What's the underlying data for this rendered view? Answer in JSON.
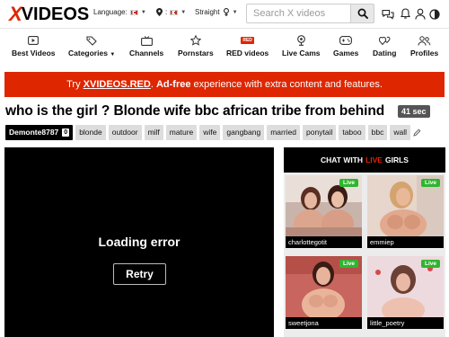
{
  "header": {
    "logo_x": "X",
    "logo_text": "VIDEOS",
    "language_label": "Language:",
    "location_label": ":",
    "orientation_label": "Straight",
    "search_placeholder": "Search X videos"
  },
  "nav": [
    {
      "label": "Best Videos",
      "icon": "play-square-icon"
    },
    {
      "label": "Categories",
      "icon": "tags-icon"
    },
    {
      "label": "Channels",
      "icon": "tv-icon"
    },
    {
      "label": "Pornstars",
      "icon": "star-icon"
    },
    {
      "label": "RED videos",
      "icon": "red-badge-icon",
      "badge": "RED"
    },
    {
      "label": "Live Cams",
      "icon": "webcam-icon"
    },
    {
      "label": "Games",
      "icon": "gamepad-icon"
    },
    {
      "label": "Dating",
      "icon": "hearts-icon"
    },
    {
      "label": "Profiles",
      "icon": "profiles-icon"
    }
  ],
  "promo": {
    "prefix": "Try ",
    "brand": "XVIDEOS.RED",
    "middle": ". ",
    "adfree": "Ad-free",
    "suffix": " experience with extra content and features."
  },
  "video": {
    "title": "who is the girl ? Blonde wife bbc african tribe from behind",
    "duration": "41 sec",
    "uploader": "Demonte8787",
    "uploader_count": "0",
    "tags": [
      "blonde",
      "outdoor",
      "milf",
      "mature",
      "wife",
      "gangbang",
      "married",
      "ponytail",
      "taboo",
      "bbc",
      "wall"
    ]
  },
  "player": {
    "error_text": "Loading error",
    "retry_label": "Retry"
  },
  "live": {
    "head_prefix": "CHAT WITH",
    "head_live": "LIVE",
    "head_suffix": "GIRLS",
    "badge": "Live",
    "cams": [
      {
        "name": "charlottegotit"
      },
      {
        "name": "emmiep"
      },
      {
        "name": "sweetjona"
      },
      {
        "name": "little_poetry"
      }
    ]
  },
  "colors": {
    "brand_red": "#de2600",
    "live_green": "#2fb52f"
  }
}
